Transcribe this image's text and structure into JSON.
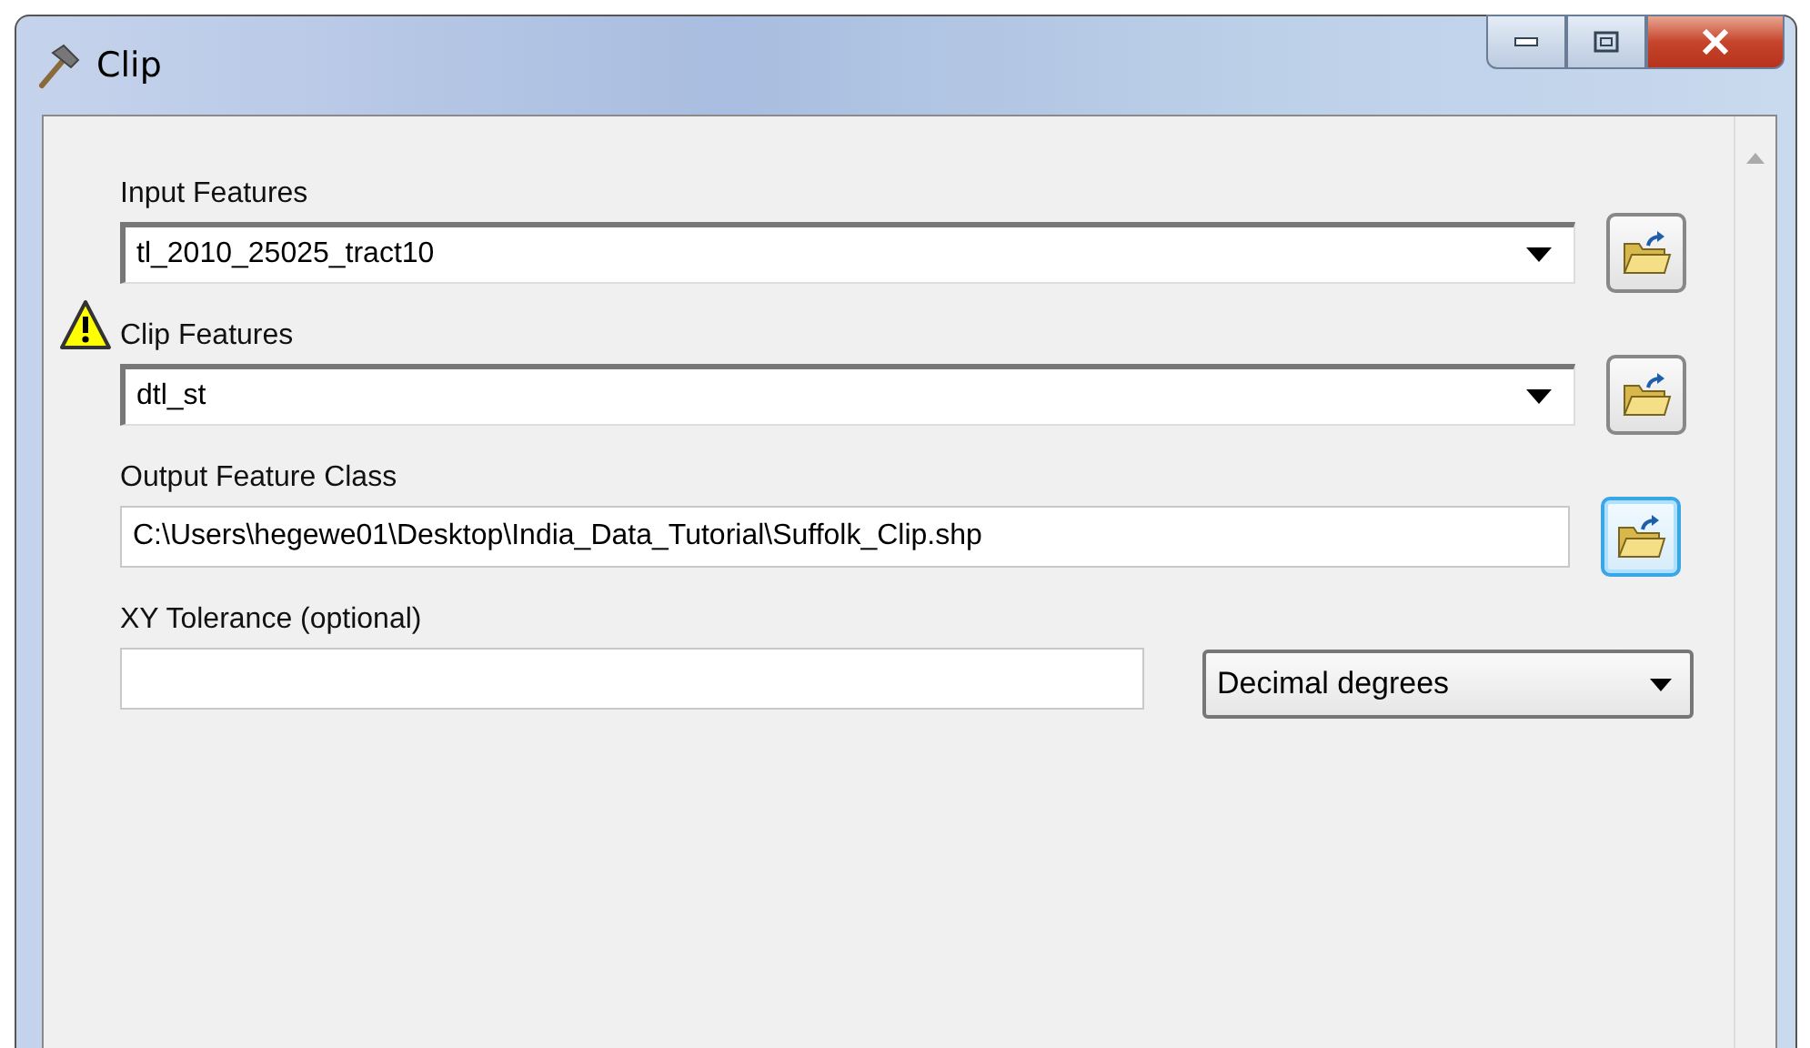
{
  "window": {
    "title": "Clip"
  },
  "parameters": [
    {
      "label": "Input Features",
      "kind": "combo",
      "value": "tl_2010_25025_tract10",
      "warning": false,
      "browse_focused": false
    },
    {
      "label": "Clip Features",
      "kind": "combo",
      "value": "dtl_st",
      "warning": true,
      "browse_focused": false
    },
    {
      "label": "Output Feature Class",
      "kind": "text",
      "value": "C:\\Users\\hegewe01\\Desktop\\India_Data_Tutorial\\Suffolk_Clip.shp",
      "warning": false,
      "browse_focused": true
    },
    {
      "label": "XY Tolerance (optional)",
      "kind": "units",
      "unit": "Decimal degrees"
    }
  ]
}
